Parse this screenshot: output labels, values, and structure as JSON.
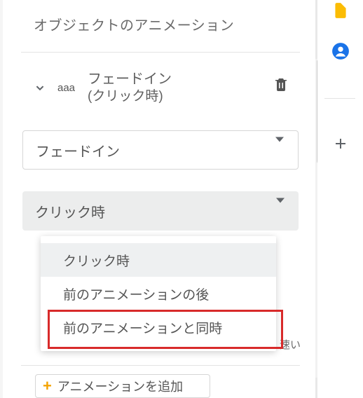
{
  "panel": {
    "title": "オブジェクトのアニメーション"
  },
  "animation_item": {
    "tag": "aaa",
    "name": "フェードイン",
    "subtitle": "(クリック時)"
  },
  "effect_select": {
    "value": "フェードイン"
  },
  "trigger_select": {
    "value": "クリック時"
  },
  "trigger_options": [
    "クリック時",
    "前のアニメーションの後",
    "前のアニメーションと同時"
  ],
  "speed": {
    "fast_label": "速い"
  },
  "add_button": {
    "label": "アニメーションを追加"
  }
}
